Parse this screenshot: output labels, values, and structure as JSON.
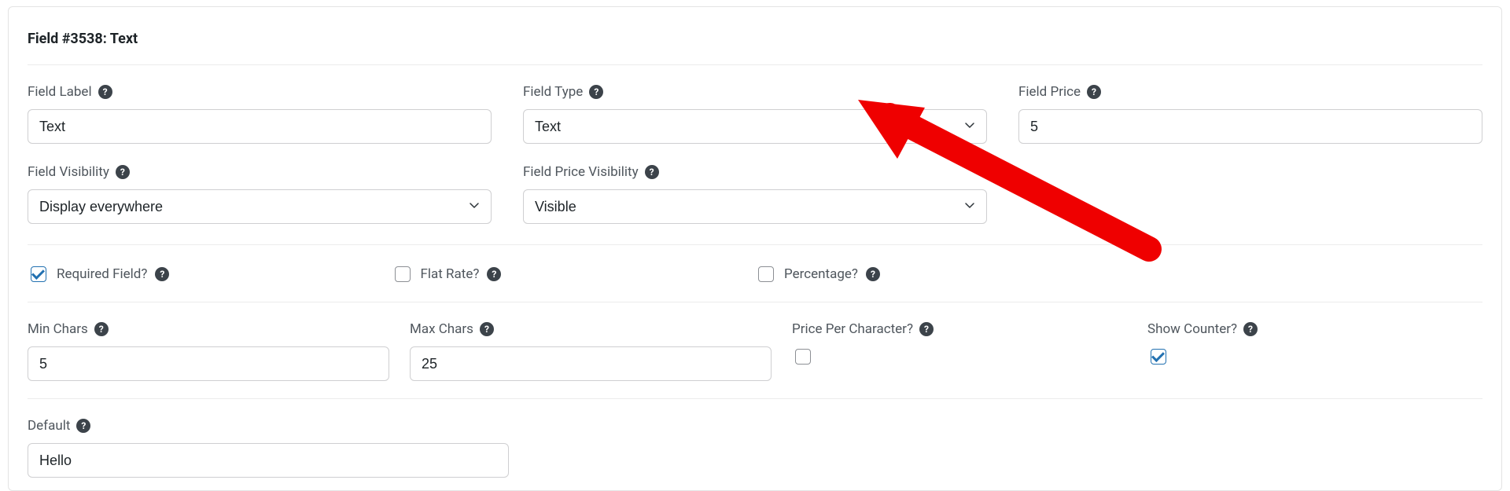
{
  "panel": {
    "title": "Field #3538: Text"
  },
  "labels": {
    "field_label": "Field Label",
    "field_type": "Field Type",
    "field_price": "Field Price",
    "field_visibility": "Field Visibility",
    "field_price_visibility": "Field Price Visibility",
    "required_field": "Required Field?",
    "flat_rate": "Flat Rate?",
    "percentage": "Percentage?",
    "min_chars": "Min Chars",
    "max_chars": "Max Chars",
    "price_per_character": "Price Per Character?",
    "show_counter": "Show Counter?",
    "default": "Default"
  },
  "values": {
    "field_label": "Text",
    "field_type": "Text",
    "field_price": "5",
    "field_visibility": "Display everywhere",
    "field_price_visibility": "Visible",
    "min_chars": "5",
    "max_chars": "25",
    "default": "Hello"
  },
  "checks": {
    "required_field": true,
    "flat_rate": false,
    "percentage": false,
    "price_per_character": false,
    "show_counter": true
  },
  "icons": {
    "help_glyph": "?"
  }
}
